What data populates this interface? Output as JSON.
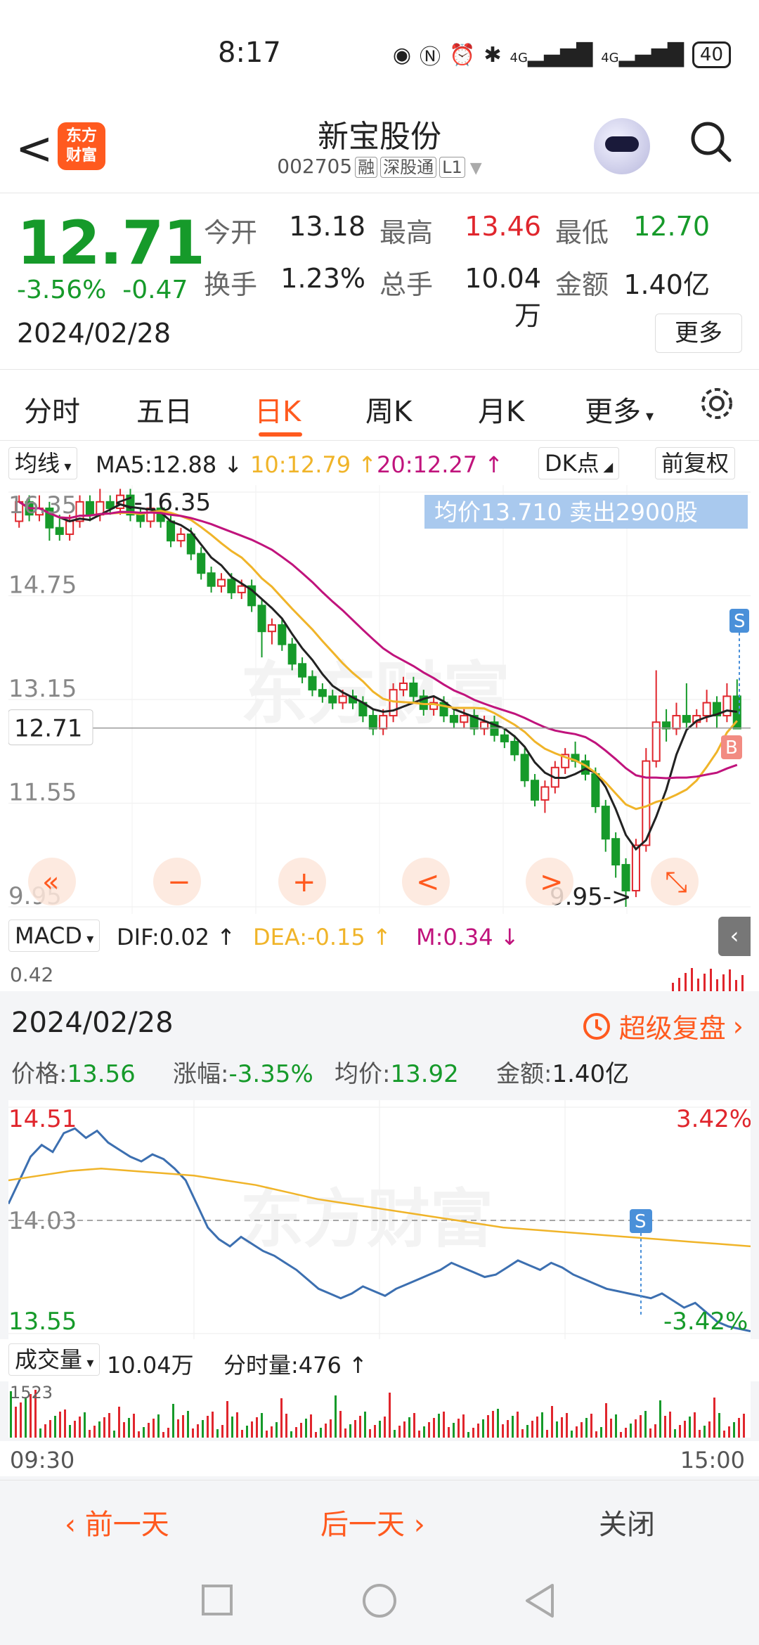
{
  "status": {
    "time": "8:17",
    "battery": "40",
    "net1": "4G",
    "net2": "4G"
  },
  "header": {
    "back": "<",
    "logo_line1": "东方",
    "logo_line2": "财富",
    "title": "新宝股份",
    "code": "002705",
    "tags": [
      "融",
      "深股通",
      "L1"
    ]
  },
  "quote": {
    "price": "12.71",
    "pct": "-3.56%",
    "change": "-0.47",
    "date": "2024/02/28",
    "rows": [
      [
        {
          "k": "今开",
          "v": "13.18",
          "c": "dark"
        },
        {
          "k": "最高",
          "v": "13.46",
          "c": "red"
        },
        {
          "k": "最低",
          "v": "12.70",
          "c": "green"
        }
      ],
      [
        {
          "k": "换手",
          "v": "1.23%",
          "c": "dark"
        },
        {
          "k": "总手",
          "v": "10.04万",
          "c": "dark"
        },
        {
          "k": "金额",
          "v": "1.40亿",
          "c": "dark"
        }
      ]
    ],
    "more": "更多"
  },
  "tabs": [
    "分时",
    "五日",
    "日K",
    "周K",
    "月K",
    "更多"
  ],
  "tab_active": 2,
  "ma": {
    "selector": "均线",
    "ma5": "MA5:12.88",
    "ma10": "10:12.79",
    "ma20": "20:12.27",
    "dk": "DK点",
    "adj": "前复权"
  },
  "kline": {
    "y_labels": [
      "16.35",
      "14.75",
      "13.15",
      "11.55",
      "9.95"
    ],
    "current": "12.71",
    "max_note": "<-16.35",
    "min_note": "9.95->",
    "banner": "均价13.710  卖出2900股",
    "s_mark": "S",
    "b_mark": "B",
    "controls": [
      "«",
      "−",
      "+",
      "<",
      ">",
      "⤡"
    ],
    "watermark": "东方财富",
    "candles": [
      [
        15.9,
        16.2,
        16.3,
        15.8
      ],
      [
        16.2,
        16.0,
        16.3,
        15.9
      ],
      [
        16.0,
        16.1,
        16.3,
        15.9
      ],
      [
        16.1,
        15.8,
        16.2,
        15.6
      ],
      [
        15.8,
        15.7,
        16.0,
        15.6
      ],
      [
        15.7,
        15.9,
        16.0,
        15.6
      ],
      [
        15.9,
        16.2,
        16.3,
        15.8
      ],
      [
        16.2,
        16.0,
        16.3,
        15.9
      ],
      [
        16.0,
        16.2,
        16.4,
        15.9
      ],
      [
        16.2,
        16.1,
        16.3,
        16.0
      ],
      [
        16.1,
        16.3,
        16.4,
        16.0
      ],
      [
        16.3,
        16.0,
        16.4,
        15.9
      ],
      [
        16.0,
        15.9,
        16.1,
        15.8
      ],
      [
        15.9,
        16.1,
        16.2,
        15.8
      ],
      [
        16.1,
        15.9,
        16.2,
        15.8
      ],
      [
        15.9,
        15.6,
        16.0,
        15.5
      ],
      [
        15.6,
        15.7,
        15.8,
        15.5
      ],
      [
        15.7,
        15.4,
        15.8,
        15.3
      ],
      [
        15.4,
        15.1,
        15.5,
        15.0
      ],
      [
        15.1,
        14.9,
        15.2,
        14.8
      ],
      [
        14.9,
        15.0,
        15.1,
        14.8
      ],
      [
        15.0,
        14.8,
        15.1,
        14.7
      ],
      [
        14.8,
        14.9,
        15.0,
        14.7
      ],
      [
        14.9,
        14.6,
        15.0,
        14.5
      ],
      [
        14.6,
        14.2,
        14.7,
        13.8
      ],
      [
        14.2,
        14.3,
        14.4,
        14.0
      ],
      [
        14.3,
        14.0,
        14.4,
        13.9
      ],
      [
        14.0,
        13.7,
        14.1,
        13.6
      ],
      [
        13.7,
        13.5,
        13.8,
        13.4
      ],
      [
        13.5,
        13.3,
        13.6,
        13.2
      ],
      [
        13.3,
        13.2,
        13.4,
        13.1
      ],
      [
        13.2,
        13.1,
        13.3,
        13.0
      ],
      [
        13.1,
        13.2,
        13.3,
        13.0
      ],
      [
        13.2,
        13.1,
        13.3,
        13.0
      ],
      [
        13.1,
        12.9,
        13.2,
        12.8
      ],
      [
        12.9,
        12.7,
        13.0,
        12.6
      ],
      [
        12.7,
        12.9,
        13.0,
        12.6
      ],
      [
        12.9,
        13.3,
        13.4,
        12.8
      ],
      [
        13.3,
        13.4,
        13.5,
        13.2
      ],
      [
        13.4,
        13.2,
        13.5,
        13.1
      ],
      [
        13.2,
        13.0,
        13.3,
        12.9
      ],
      [
        13.0,
        13.1,
        13.2,
        12.9
      ],
      [
        13.1,
        12.9,
        13.2,
        12.8
      ],
      [
        12.9,
        12.8,
        13.0,
        12.7
      ],
      [
        12.8,
        12.9,
        13.0,
        12.7
      ],
      [
        12.9,
        12.7,
        13.0,
        12.6
      ],
      [
        12.7,
        12.8,
        12.9,
        12.6
      ],
      [
        12.8,
        12.6,
        12.9,
        12.5
      ],
      [
        12.6,
        12.5,
        12.7,
        12.4
      ],
      [
        12.5,
        12.3,
        12.6,
        12.2
      ],
      [
        12.3,
        11.9,
        12.4,
        11.8
      ],
      [
        11.9,
        11.6,
        12.0,
        11.5
      ],
      [
        11.6,
        11.8,
        11.9,
        11.4
      ],
      [
        11.8,
        12.1,
        12.2,
        11.7
      ],
      [
        12.1,
        12.3,
        12.4,
        12.0
      ],
      [
        12.3,
        12.2,
        12.5,
        12.1
      ],
      [
        12.2,
        12.0,
        12.3,
        11.9
      ],
      [
        12.0,
        11.5,
        12.1,
        11.4
      ],
      [
        11.5,
        11.0,
        11.6,
        10.8
      ],
      [
        11.0,
        10.6,
        11.1,
        10.4
      ],
      [
        10.6,
        10.2,
        10.7,
        9.95
      ],
      [
        10.2,
        10.9,
        11.0,
        10.1
      ],
      [
        10.9,
        12.2,
        12.4,
        10.8
      ],
      [
        12.2,
        12.8,
        13.6,
        12.1
      ],
      [
        12.8,
        12.7,
        13.0,
        12.5
      ],
      [
        12.7,
        12.9,
        13.1,
        12.6
      ],
      [
        12.9,
        12.8,
        13.4,
        12.7
      ],
      [
        12.8,
        12.9,
        13.0,
        12.7
      ],
      [
        12.9,
        13.1,
        13.3,
        12.8
      ],
      [
        13.1,
        12.9,
        13.2,
        12.7
      ],
      [
        12.9,
        13.2,
        13.4,
        12.8
      ],
      [
        13.2,
        12.7,
        13.46,
        12.7
      ]
    ]
  },
  "macd": {
    "selector": "MACD",
    "dif": "DIF:0.02",
    "dea": "DEA:-0.15",
    "m": "M:0.34",
    "top_label": "0.42"
  },
  "summary": {
    "date": "2024/02/28",
    "replay": "超级复盘",
    "items": [
      {
        "k": "价格:",
        "v": "13.56"
      },
      {
        "k": "涨幅:",
        "v": "-3.35%"
      },
      {
        "k": "均价:",
        "v": "13.92"
      },
      {
        "k": "金额:",
        "v": "1.40亿"
      }
    ]
  },
  "intraday": {
    "y_top": "14.51",
    "y_mid": "14.03",
    "y_bot": "13.55",
    "pct_top": "3.42%",
    "pct_bot": "-3.42%",
    "s_mark": "S",
    "watermark": "东方财富",
    "price_series": [
      14.1,
      14.2,
      14.3,
      14.35,
      14.32,
      14.4,
      14.42,
      14.38,
      14.41,
      14.36,
      14.33,
      14.3,
      14.28,
      14.31,
      14.29,
      14.25,
      14.2,
      14.1,
      14.0,
      13.95,
      13.92,
      13.96,
      13.93,
      13.9,
      13.88,
      13.85,
      13.82,
      13.78,
      13.74,
      13.72,
      13.7,
      13.72,
      13.75,
      13.73,
      13.71,
      13.74,
      13.76,
      13.78,
      13.8,
      13.82,
      13.85,
      13.83,
      13.81,
      13.79,
      13.8,
      13.83,
      13.86,
      13.84,
      13.82,
      13.85,
      13.83,
      13.8,
      13.78,
      13.76,
      13.74,
      13.73,
      13.72,
      13.71,
      13.7,
      13.72,
      13.69,
      13.66,
      13.68,
      13.64,
      13.6,
      13.58,
      13.57,
      13.56
    ],
    "avg_series": [
      14.2,
      14.22,
      14.24,
      14.25,
      14.24,
      14.23,
      14.22,
      14.2,
      14.18,
      14.15,
      14.12,
      14.1,
      14.08,
      14.06,
      14.04,
      14.02,
      14.0,
      13.99,
      13.98,
      13.97,
      13.96,
      13.95,
      13.94,
      13.93,
      13.92
    ]
  },
  "volume": {
    "selector": "成交量",
    "total": "10.04万",
    "minute": "分时量:476",
    "top_label": "1523",
    "t_start": "09:30",
    "t_end": "15:00"
  },
  "actions": {
    "prev": "前一天",
    "next": "后一天",
    "close": "关闭"
  },
  "colors": {
    "accent": "#ff5a1f",
    "up": "#e0262d",
    "down": "#169a2a",
    "ma5": "#222222",
    "ma10": "#f0b429",
    "ma20": "#c0137c",
    "blue": "#4a90d9"
  }
}
